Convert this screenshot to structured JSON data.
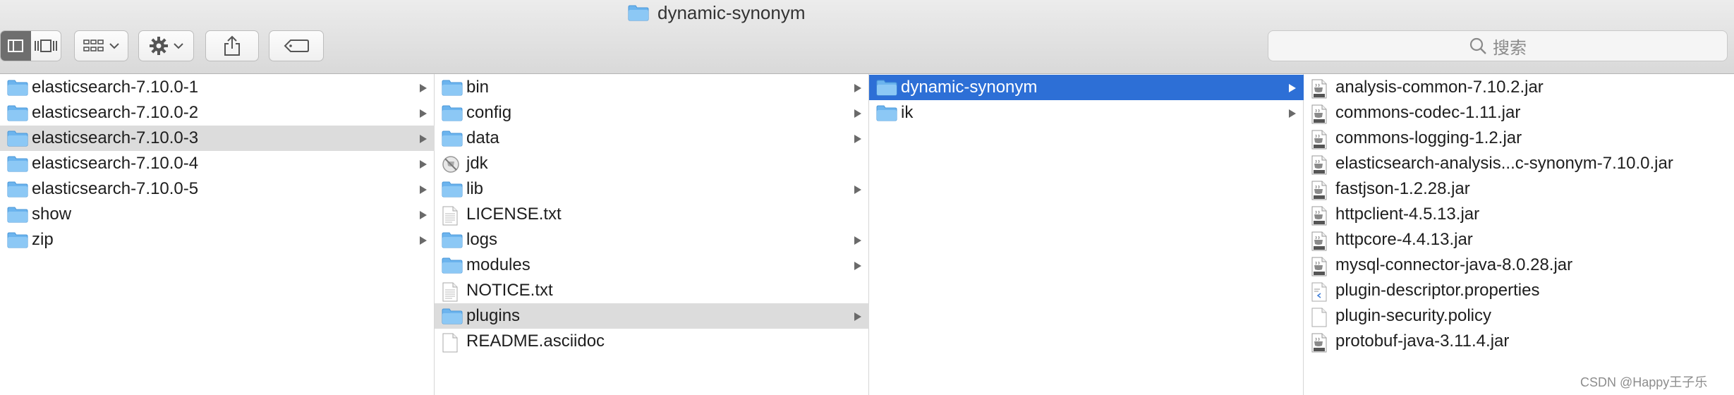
{
  "window": {
    "title": "dynamic-synonym"
  },
  "search": {
    "placeholder": "搜索"
  },
  "columns": [
    {
      "items": [
        {
          "label": "elasticsearch-7.10.0-1",
          "icon": "folder-icon",
          "has_children": true
        },
        {
          "label": "elasticsearch-7.10.0-2",
          "icon": "folder-icon",
          "has_children": true
        },
        {
          "label": "elasticsearch-7.10.0-3",
          "icon": "folder-icon",
          "has_children": true,
          "selected": "gray"
        },
        {
          "label": "elasticsearch-7.10.0-4",
          "icon": "folder-icon",
          "has_children": true
        },
        {
          "label": "elasticsearch-7.10.0-5",
          "icon": "folder-icon",
          "has_children": true
        },
        {
          "label": "show",
          "icon": "folder-icon",
          "has_children": true
        },
        {
          "label": "zip",
          "icon": "folder-icon",
          "has_children": true
        }
      ]
    },
    {
      "items": [
        {
          "label": "bin",
          "icon": "folder-icon",
          "has_children": true
        },
        {
          "label": "config",
          "icon": "folder-icon",
          "has_children": true
        },
        {
          "label": "data",
          "icon": "folder-icon",
          "has_children": true
        },
        {
          "label": "jdk",
          "icon": "disabled-app-icon",
          "has_children": false
        },
        {
          "label": "lib",
          "icon": "folder-icon",
          "has_children": true
        },
        {
          "label": "LICENSE.txt",
          "icon": "text-file-icon",
          "has_children": false
        },
        {
          "label": "logs",
          "icon": "folder-icon",
          "has_children": true
        },
        {
          "label": "modules",
          "icon": "folder-icon",
          "has_children": true
        },
        {
          "label": "NOTICE.txt",
          "icon": "text-file-icon",
          "has_children": false
        },
        {
          "label": "plugins",
          "icon": "folder-icon",
          "has_children": true,
          "selected": "gray"
        },
        {
          "label": "README.asciidoc",
          "icon": "blank-file-icon",
          "has_children": false
        }
      ]
    },
    {
      "items": [
        {
          "label": "dynamic-synonym",
          "icon": "folder-icon",
          "has_children": true,
          "selected": "blue"
        },
        {
          "label": "ik",
          "icon": "folder-icon",
          "has_children": true
        }
      ]
    },
    {
      "items": [
        {
          "label": "analysis-common-7.10.2.jar",
          "icon": "jar-file-icon",
          "has_children": false
        },
        {
          "label": "commons-codec-1.11.jar",
          "icon": "jar-file-icon",
          "has_children": false
        },
        {
          "label": "commons-logging-1.2.jar",
          "icon": "jar-file-icon",
          "has_children": false
        },
        {
          "label": "elasticsearch-analysis...c-synonym-7.10.0.jar",
          "icon": "jar-file-icon",
          "has_children": false
        },
        {
          "label": "fastjson-1.2.28.jar",
          "icon": "jar-file-icon",
          "has_children": false
        },
        {
          "label": "httpclient-4.5.13.jar",
          "icon": "jar-file-icon",
          "has_children": false
        },
        {
          "label": "httpcore-4.4.13.jar",
          "icon": "jar-file-icon",
          "has_children": false
        },
        {
          "label": "mysql-connector-java-8.0.28.jar",
          "icon": "jar-file-icon",
          "has_children": false
        },
        {
          "label": "plugin-descriptor.properties",
          "icon": "properties-file-icon",
          "has_children": false
        },
        {
          "label": "plugin-security.policy",
          "icon": "blank-file-icon",
          "has_children": false
        },
        {
          "label": "protobuf-java-3.11.4.jar",
          "icon": "jar-file-icon",
          "has_children": false
        }
      ]
    }
  ],
  "watermark": "CSDN @Happy王子乐",
  "colors": {
    "selection_blue": "#2d6fd6",
    "selection_gray": "#dcdcdc",
    "folder_blue": "#6cb4ee"
  }
}
